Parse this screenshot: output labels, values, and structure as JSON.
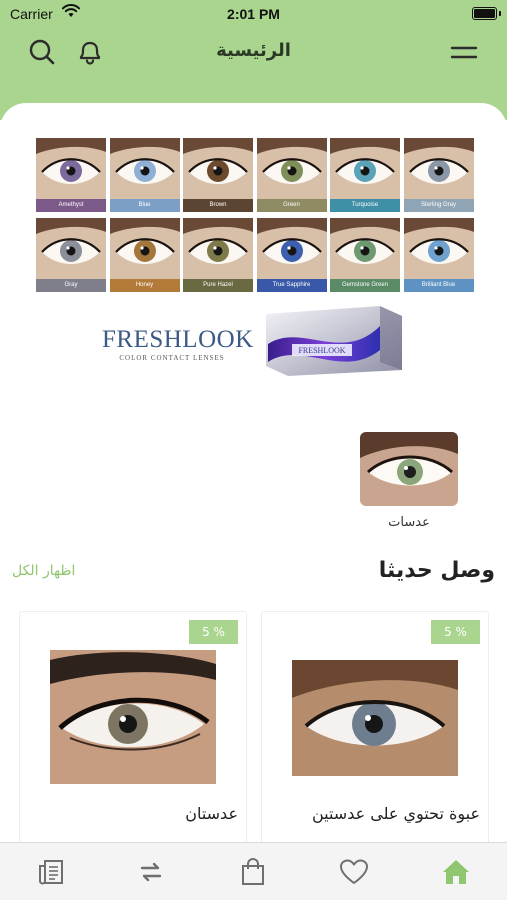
{
  "status_bar": {
    "carrier": "Carrier",
    "time": "2:01 PM"
  },
  "header": {
    "title": "الرئيسية",
    "icons": [
      "menu-icon",
      "bell-icon",
      "search-icon"
    ]
  },
  "banner": {
    "swatches": [
      "Amethyst",
      "Blue",
      "Brown",
      "Green",
      "Turquoise",
      "Sterling Gray",
      "Gray",
      "Honey",
      "Pure Hazel",
      "True Sapphire",
      "Gemstone Green",
      "Brilliant Blue"
    ],
    "brand_logo": "FRESHLOOK",
    "brand_sub": "COLOR CONTACT LENSES",
    "box_label": "FRESHLOOK"
  },
  "categories": [
    {
      "label": "عدسات"
    }
  ],
  "new_arrivals": {
    "title": "وصل حديثا",
    "show_all": "اظهار الكل",
    "products": [
      {
        "name": "عبوة تحتوي على عدستين",
        "discount": "5 %"
      },
      {
        "name": "عدستان",
        "discount": "5 %"
      }
    ]
  },
  "tab_bar": {
    "items": [
      "home-icon",
      "heart-icon",
      "bag-icon",
      "exchange-icon",
      "document-icon"
    ]
  },
  "colors": {
    "accent": "#a9d58e",
    "link": "#8fc66f",
    "active_tab": "#8fc66f",
    "inactive_tab": "#6f6f6f"
  }
}
